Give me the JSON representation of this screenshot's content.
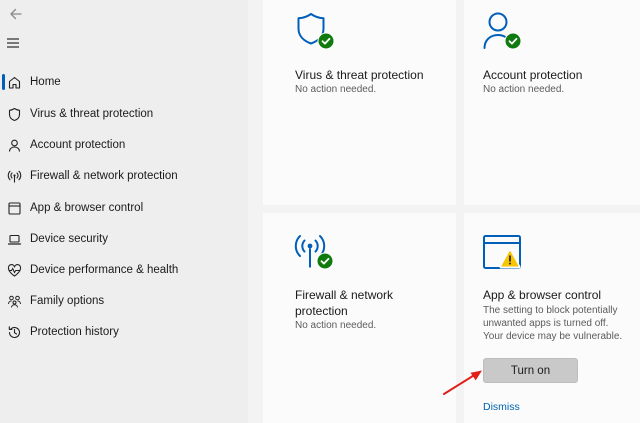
{
  "sidebar": {
    "items": [
      {
        "label": "Home",
        "icon": "home-icon"
      },
      {
        "label": "Virus & threat protection",
        "icon": "shield-icon"
      },
      {
        "label": "Account protection",
        "icon": "person-icon"
      },
      {
        "label": "Firewall & network protection",
        "icon": "wifi-antenna-icon"
      },
      {
        "label": "App & browser control",
        "icon": "app-window-icon"
      },
      {
        "label": "Device security",
        "icon": "laptop-icon"
      },
      {
        "label": "Device performance & health",
        "icon": "heart-pulse-icon"
      },
      {
        "label": "Family options",
        "icon": "family-icon"
      },
      {
        "label": "Protection history",
        "icon": "history-icon"
      }
    ]
  },
  "cards": {
    "virus": {
      "title": "Virus & threat protection",
      "status": "No action needed."
    },
    "account": {
      "title": "Account protection",
      "status": "No action needed."
    },
    "firewall": {
      "title_line1": "Firewall & network",
      "title_line2": "protection",
      "status": "No action needed."
    },
    "app": {
      "title": "App & browser control",
      "desc_line1": "The setting to block potentially",
      "desc_line2": "unwanted apps is turned off.",
      "desc_line3": "Your device may be vulnerable.",
      "button_label": "Turn on",
      "dismiss_label": "Dismiss"
    }
  },
  "colors": {
    "accent": "#005fb8",
    "success": "#0f7b0f",
    "warning": "#f7c600",
    "arrow": "#e0201b"
  }
}
